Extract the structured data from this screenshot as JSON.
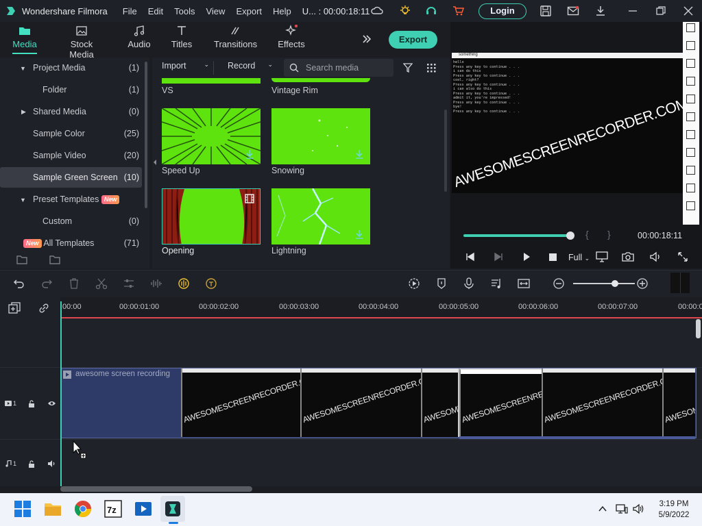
{
  "titlebar": {
    "app_name": "Wondershare Filmora",
    "menus": [
      "File",
      "Edit",
      "Tools",
      "View",
      "Export",
      "Help"
    ],
    "project": "U... : 00:00:18:11",
    "login": "Login"
  },
  "media_tabs": [
    {
      "label": "Media",
      "icon": "folder-icon",
      "active": true
    },
    {
      "label": "Stock Media",
      "icon": "image-icon",
      "active": false
    },
    {
      "label": "Audio",
      "icon": "music-icon",
      "active": false
    },
    {
      "label": "Titles",
      "icon": "text-icon",
      "active": false
    },
    {
      "label": "Transitions",
      "icon": "transition-icon",
      "active": false
    },
    {
      "label": "Effects",
      "icon": "sparkle-icon",
      "active": false
    }
  ],
  "export_label": "Export",
  "sidebar": {
    "items": [
      {
        "label": "Project Media",
        "count": "(1)"
      },
      {
        "label": "Folder",
        "count": "(1)"
      },
      {
        "label": "Shared Media",
        "count": "(0)"
      },
      {
        "label": "Sample Color",
        "count": "(25)"
      },
      {
        "label": "Sample Video",
        "count": "(20)"
      },
      {
        "label": "Sample Green Screen",
        "count": "(10)",
        "selected": true
      },
      {
        "label": "Preset Templates",
        "count": ""
      },
      {
        "label": "Custom",
        "count": "(0)"
      },
      {
        "label": "All Templates",
        "count": "(71)"
      }
    ],
    "new_badge": "New"
  },
  "media_toolbar": {
    "import": "Import",
    "record": "Record",
    "search_placeholder": "Search media"
  },
  "thumbs": [
    {
      "label": "VS"
    },
    {
      "label": "Vintage Rim"
    },
    {
      "label": "Speed Up"
    },
    {
      "label": "Snowing"
    },
    {
      "label": "Opening"
    },
    {
      "label": "Lightning"
    }
  ],
  "preview": {
    "timecode": "00:00:18:11",
    "quality": "Full",
    "watermark": "AWESOMESCREENRECORDER.COM",
    "console_title": "something",
    "console_lines": [
      "hello",
      "Press any key to continue . . .",
      "i can do this",
      "Press any key to continue . . .",
      "cool, right?",
      "Press any key to continue . . .",
      "i can also do this",
      "Press any key to continue . . .",
      "admit it, you're impressed!",
      "Press any key to continue . . .",
      "bye!",
      "Press any key to continue . . ."
    ],
    "progress": 1.0
  },
  "timeline": {
    "ticks": [
      ":00:00",
      "00:00:01:00",
      "00:00:02:00",
      "00:00:03:00",
      "00:00:04:00",
      "00:00:05:00",
      "00:00:06:00",
      "00:00:07:00",
      "00:00:0"
    ],
    "clip_name": "awesome screen recording",
    "frame_watermark": "AWESOMESCREENRECORDER.COM",
    "video_track_label": "1",
    "audio_track_label": "1"
  },
  "taskbar": {
    "time": "3:19 PM",
    "date": "5/9/2022"
  },
  "colors": {
    "accent": "#3fd0b4",
    "green_screen": "#5ee30f",
    "playhead_red": "#e0474c"
  }
}
